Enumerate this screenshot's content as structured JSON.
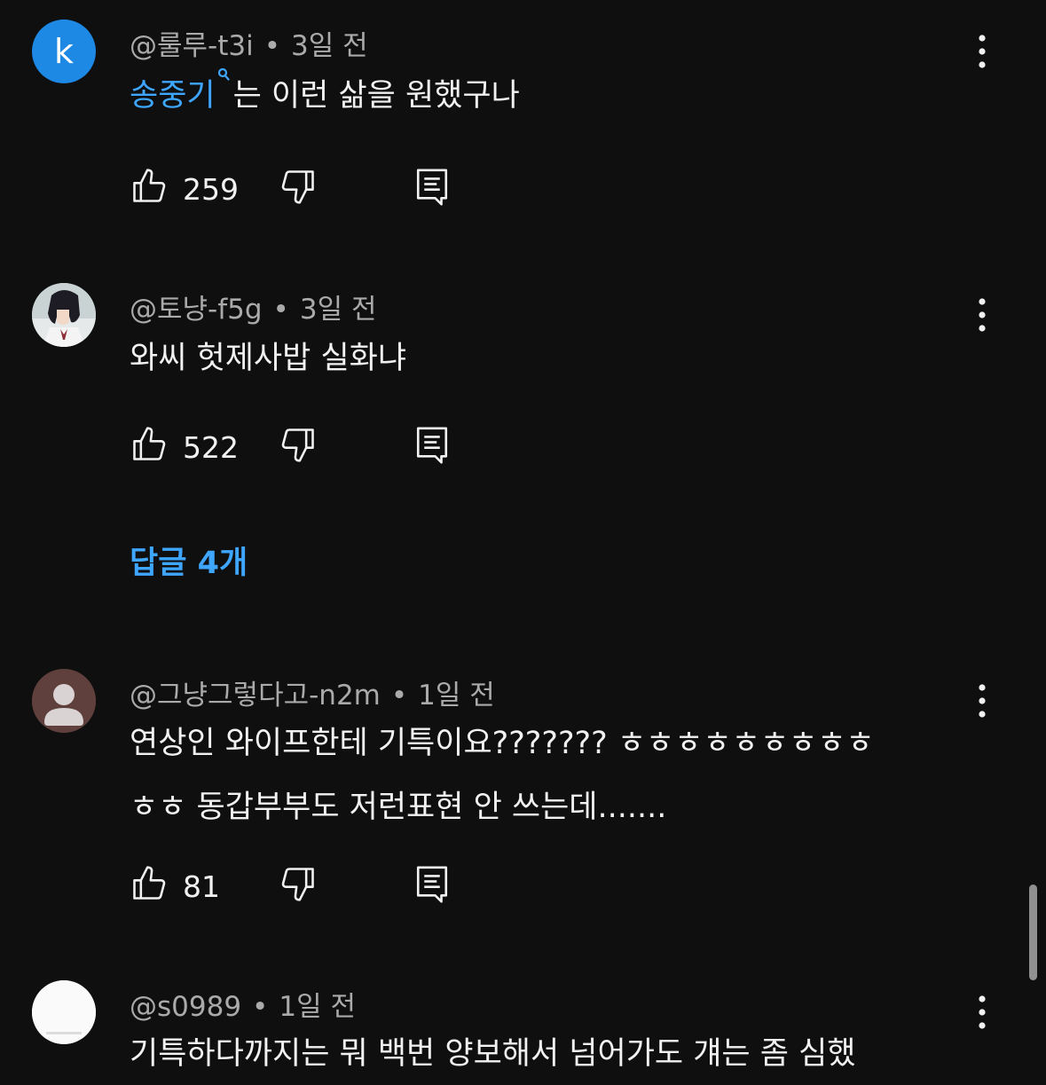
{
  "comments": [
    {
      "avatar_letter": "k",
      "author": "@룰루-t3i",
      "time": "3일 전",
      "mention": "송중기",
      "text": "는 이런 삶을 원했구나",
      "likes": "259"
    },
    {
      "author": "@토냥-f5g",
      "time": "3일 전",
      "text": "와씨 헛제사밥 실화냐",
      "likes": "522",
      "replies": "답글 4개"
    },
    {
      "author": "@그냥그렇다고-n2m",
      "time": "1일 전",
      "text_line1": "연상인 와이프한테 기특이요??????? ㅎㅎㅎㅎㅎㅎㅎㅎㅎ",
      "text_line2": "ㅎㅎ 동갑부부도 저런표현 안 쓰는데.......",
      "likes": "81"
    },
    {
      "author": "@s0989",
      "time": "1일 전",
      "text": "기특하다까지는 뭐 백번 양보해서 넘어가도 걔는 좀 심했"
    }
  ],
  "separator": "•",
  "icons": [
    "thumb-up-icon",
    "thumb-down-icon",
    "reply-icon",
    "more-vert-icon",
    "search-icon"
  ],
  "colors": {
    "background": "#0f0f0f",
    "text": "#f1f1f1",
    "secondary": "#aaaaaa",
    "link": "#3ea6ff"
  }
}
